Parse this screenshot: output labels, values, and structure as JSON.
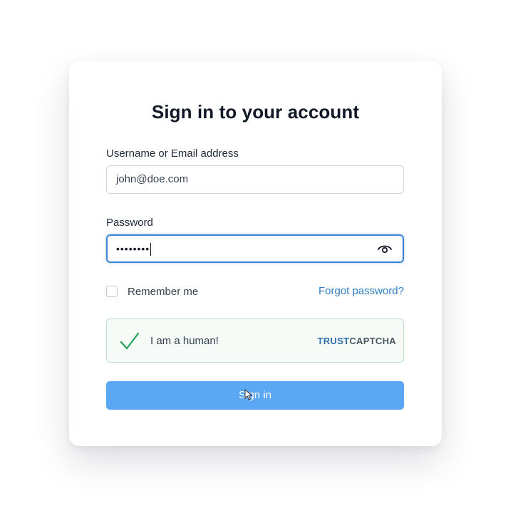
{
  "form": {
    "title": "Sign in to your account",
    "username_label": "Username or Email address",
    "username_value": "john@doe.com",
    "password_label": "Password",
    "password_value": "••••••••",
    "remember_label": "Remember me",
    "remember_checked": false,
    "forgot_link": "Forgot password?",
    "submit_label": "Sign in"
  },
  "captcha": {
    "text": "I am a human!",
    "brand_part1": "TRUST",
    "brand_part2": "CAPTCHA",
    "icon": "checkmark-icon",
    "check_color": "#22a05a"
  },
  "colors": {
    "accent": "#3b82d6",
    "button": "#5aa7f4",
    "link": "#2f7ec7"
  }
}
